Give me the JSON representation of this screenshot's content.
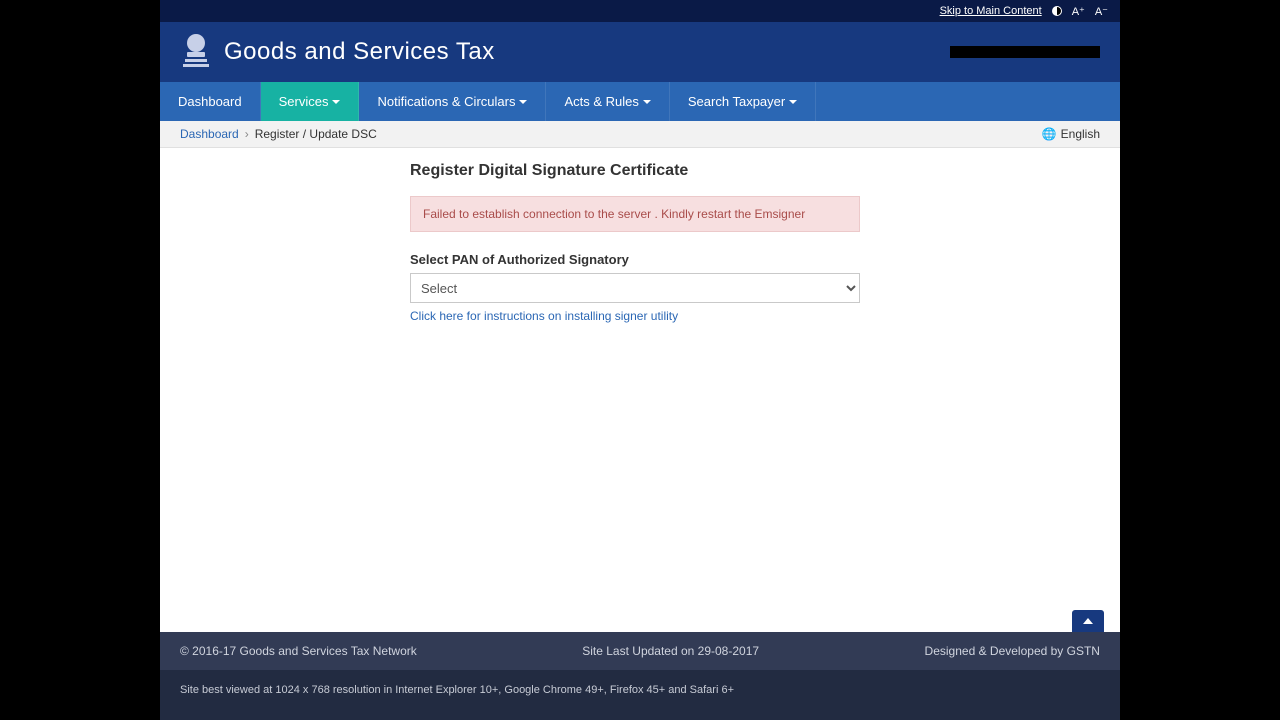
{
  "topbar": {
    "skip": "Skip to Main Content",
    "a_plus": "A⁺",
    "a_minus": "A⁻"
  },
  "header": {
    "title": "Goods and Services Tax"
  },
  "nav": {
    "items": [
      {
        "label": "Dashboard",
        "dropdown": false,
        "active": false
      },
      {
        "label": "Services",
        "dropdown": true,
        "active": true
      },
      {
        "label": "Notifications & Circulars",
        "dropdown": true,
        "active": false
      },
      {
        "label": "Acts & Rules",
        "dropdown": true,
        "active": false
      },
      {
        "label": "Search Taxpayer",
        "dropdown": true,
        "active": false
      }
    ]
  },
  "breadcrumb": {
    "root": "Dashboard",
    "current": "Register / Update DSC",
    "lang": "English"
  },
  "main": {
    "heading": "Register Digital Signature Certificate",
    "error": "Failed to establish connection to the server . Kindly restart the Emsigner",
    "pan_label": "Select PAN of Authorized Signatory",
    "pan_placeholder": "Select",
    "help_link": "Click here for instructions on installing signer utility"
  },
  "footer": {
    "copyright": "© 2016-17 Goods and Services Tax Network",
    "updated": "Site Last Updated on 29-08-2017",
    "developed": "Designed & Developed by GSTN",
    "compat": "Site best viewed at 1024 x 768 resolution in Internet Explorer 10+, Google Chrome 49+, Firefox 45+ and Safari 6+"
  }
}
